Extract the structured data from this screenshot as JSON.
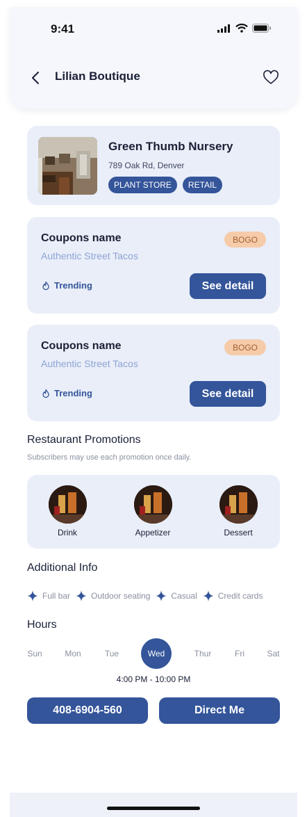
{
  "status_bar": {
    "time": "9:41"
  },
  "header": {
    "title": "Lilian Boutique",
    "back_icon": "chevron-left-icon",
    "favorite_icon": "heart-icon"
  },
  "store": {
    "name": "Green Thumb Nursery",
    "address": "789 Oak Rd, Denver",
    "tags": [
      "PLANT STORE",
      "RETAIL"
    ]
  },
  "coupons": [
    {
      "name": "Coupons name",
      "subtitle": "Authentic Street Tacos",
      "badge": "BOGO",
      "trend_label": "Trending",
      "button": "See detail"
    },
    {
      "name": "Coupons name",
      "subtitle": "Authentic Street Tacos",
      "badge": "BOGO",
      "trend_label": "Trending",
      "button": "See detail"
    }
  ],
  "promotions": {
    "title": "Restaurant Promotions",
    "subtitle": "Subscribers may use each promotion once daily.",
    "items": [
      {
        "label": "Drink"
      },
      {
        "label": "Appetizer"
      },
      {
        "label": "Dessert"
      }
    ]
  },
  "additional_info": {
    "title": "Additional Info",
    "items": [
      "Full bar",
      "Outdoor seating",
      "Casual",
      "Credit cards"
    ]
  },
  "hours": {
    "title": "Hours",
    "days": [
      "Sun",
      "Mon",
      "Tue",
      "Wed",
      "Thur",
      "Fri",
      "Sat"
    ],
    "selected_day": "Wed",
    "time_range": "4:00 PM - 10:00 PM"
  },
  "actions": {
    "phone": "408-6904-560",
    "direct": "Direct Me"
  },
  "colors": {
    "primary": "#34559a",
    "card_bg": "#e9eef8",
    "badge_bg": "#f6cba9",
    "subtitle": "#8ea3d6"
  }
}
